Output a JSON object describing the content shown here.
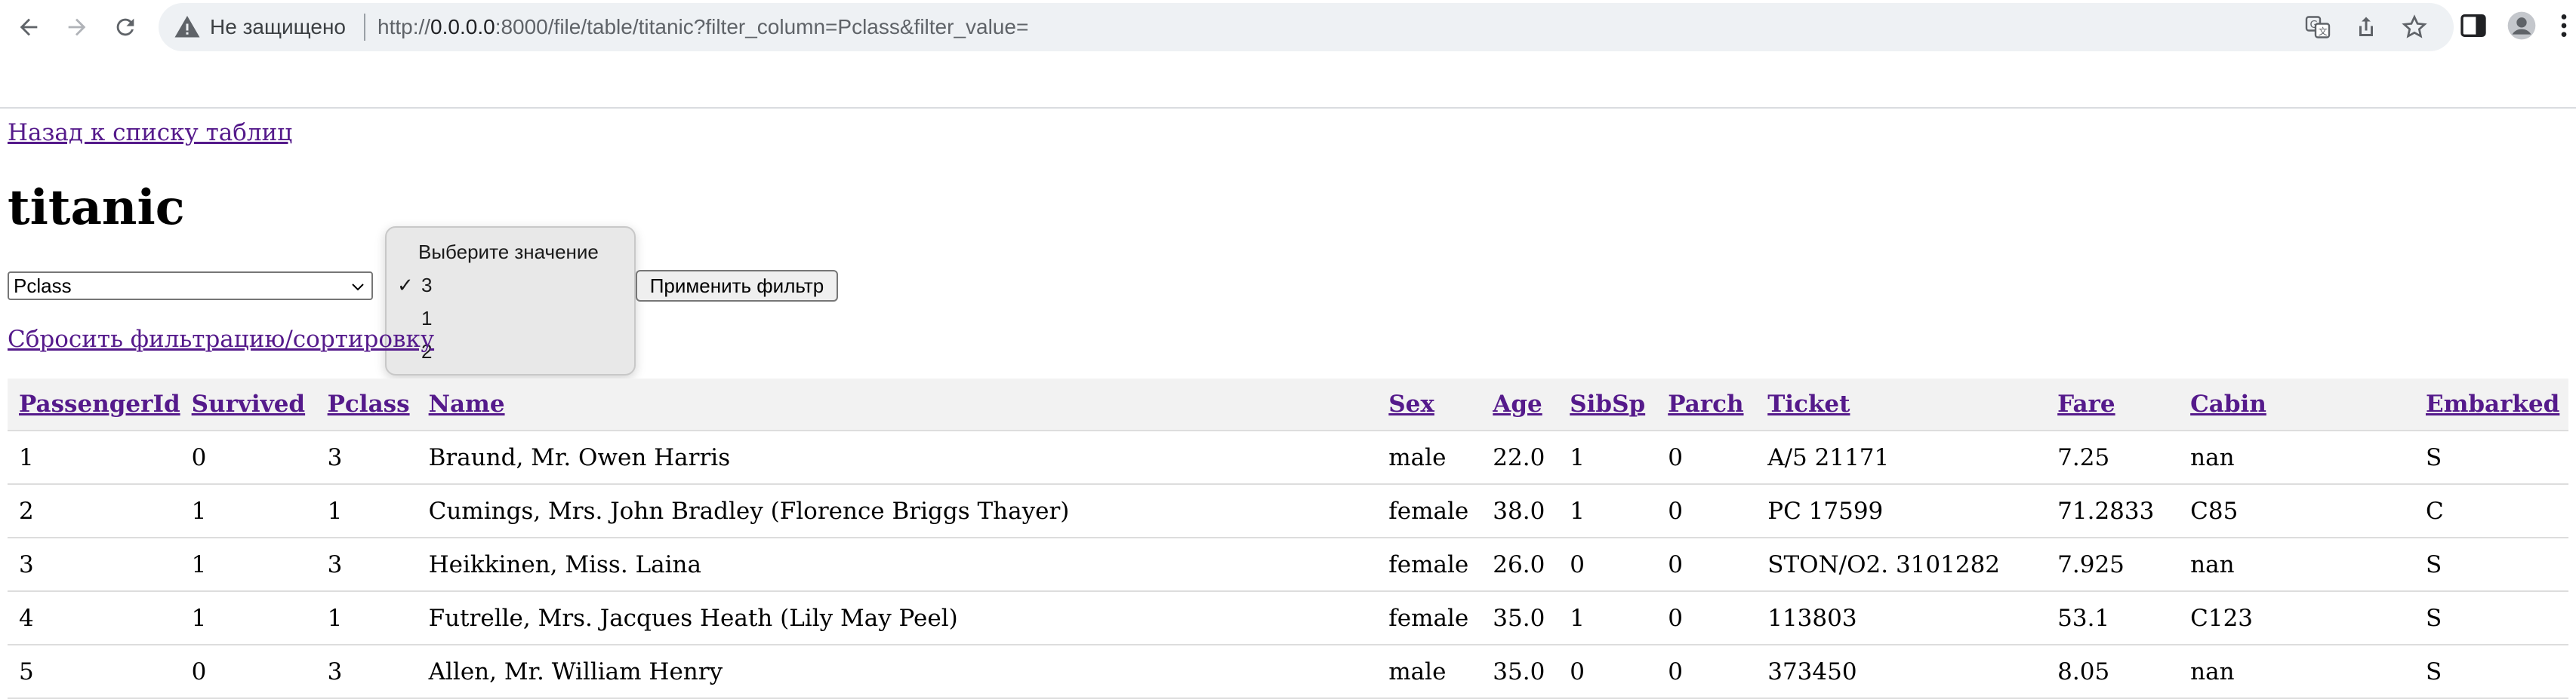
{
  "browser": {
    "security_label": "Не защищено",
    "url_scheme": "http://",
    "url_host": "0.0.0.0",
    "url_rest": ":8000/file/table/titanic?filter_column=Pclass&filter_value=",
    "icons": [
      "back-icon",
      "forward-icon",
      "reload-icon",
      "warning-icon",
      "translate-icon",
      "share-icon",
      "star-icon",
      "sidebar-icon",
      "profile-icon",
      "menu-icon"
    ]
  },
  "page": {
    "back_link": "Назад к списку таблиц",
    "title": "titanic",
    "filter": {
      "selected_column": "Pclass",
      "apply_label": "Применить фильтр",
      "dropdown_options": [
        "Выберите значение",
        "3",
        "1",
        "2"
      ],
      "dropdown_selected": "3"
    },
    "reset_link": "Сбросить фильтрацию/сортировку"
  },
  "table": {
    "columns": [
      "PassengerId",
      "Survived",
      "Pclass",
      "Name",
      "Sex",
      "Age",
      "SibSp",
      "Parch",
      "Ticket",
      "Fare",
      "Cabin",
      "Embarked"
    ],
    "rows": [
      [
        "1",
        "0",
        "3",
        "Braund, Mr. Owen Harris",
        "male",
        "22.0",
        "1",
        "0",
        "A/5 21171",
        "7.25",
        "nan",
        "S"
      ],
      [
        "2",
        "1",
        "1",
        "Cumings, Mrs. John Bradley (Florence Briggs Thayer)",
        "female",
        "38.0",
        "1",
        "0",
        "PC 17599",
        "71.2833",
        "C85",
        "C"
      ],
      [
        "3",
        "1",
        "3",
        "Heikkinen, Miss. Laina",
        "female",
        "26.0",
        "0",
        "0",
        "STON/O2. 3101282",
        "7.925",
        "nan",
        "S"
      ],
      [
        "4",
        "1",
        "1",
        "Futrelle, Mrs. Jacques Heath (Lily May Peel)",
        "female",
        "35.0",
        "1",
        "0",
        "113803",
        "53.1",
        "C123",
        "S"
      ],
      [
        "5",
        "0",
        "3",
        "Allen, Mr. William Henry",
        "male",
        "35.0",
        "0",
        "0",
        "373450",
        "8.05",
        "nan",
        "S"
      ]
    ]
  }
}
